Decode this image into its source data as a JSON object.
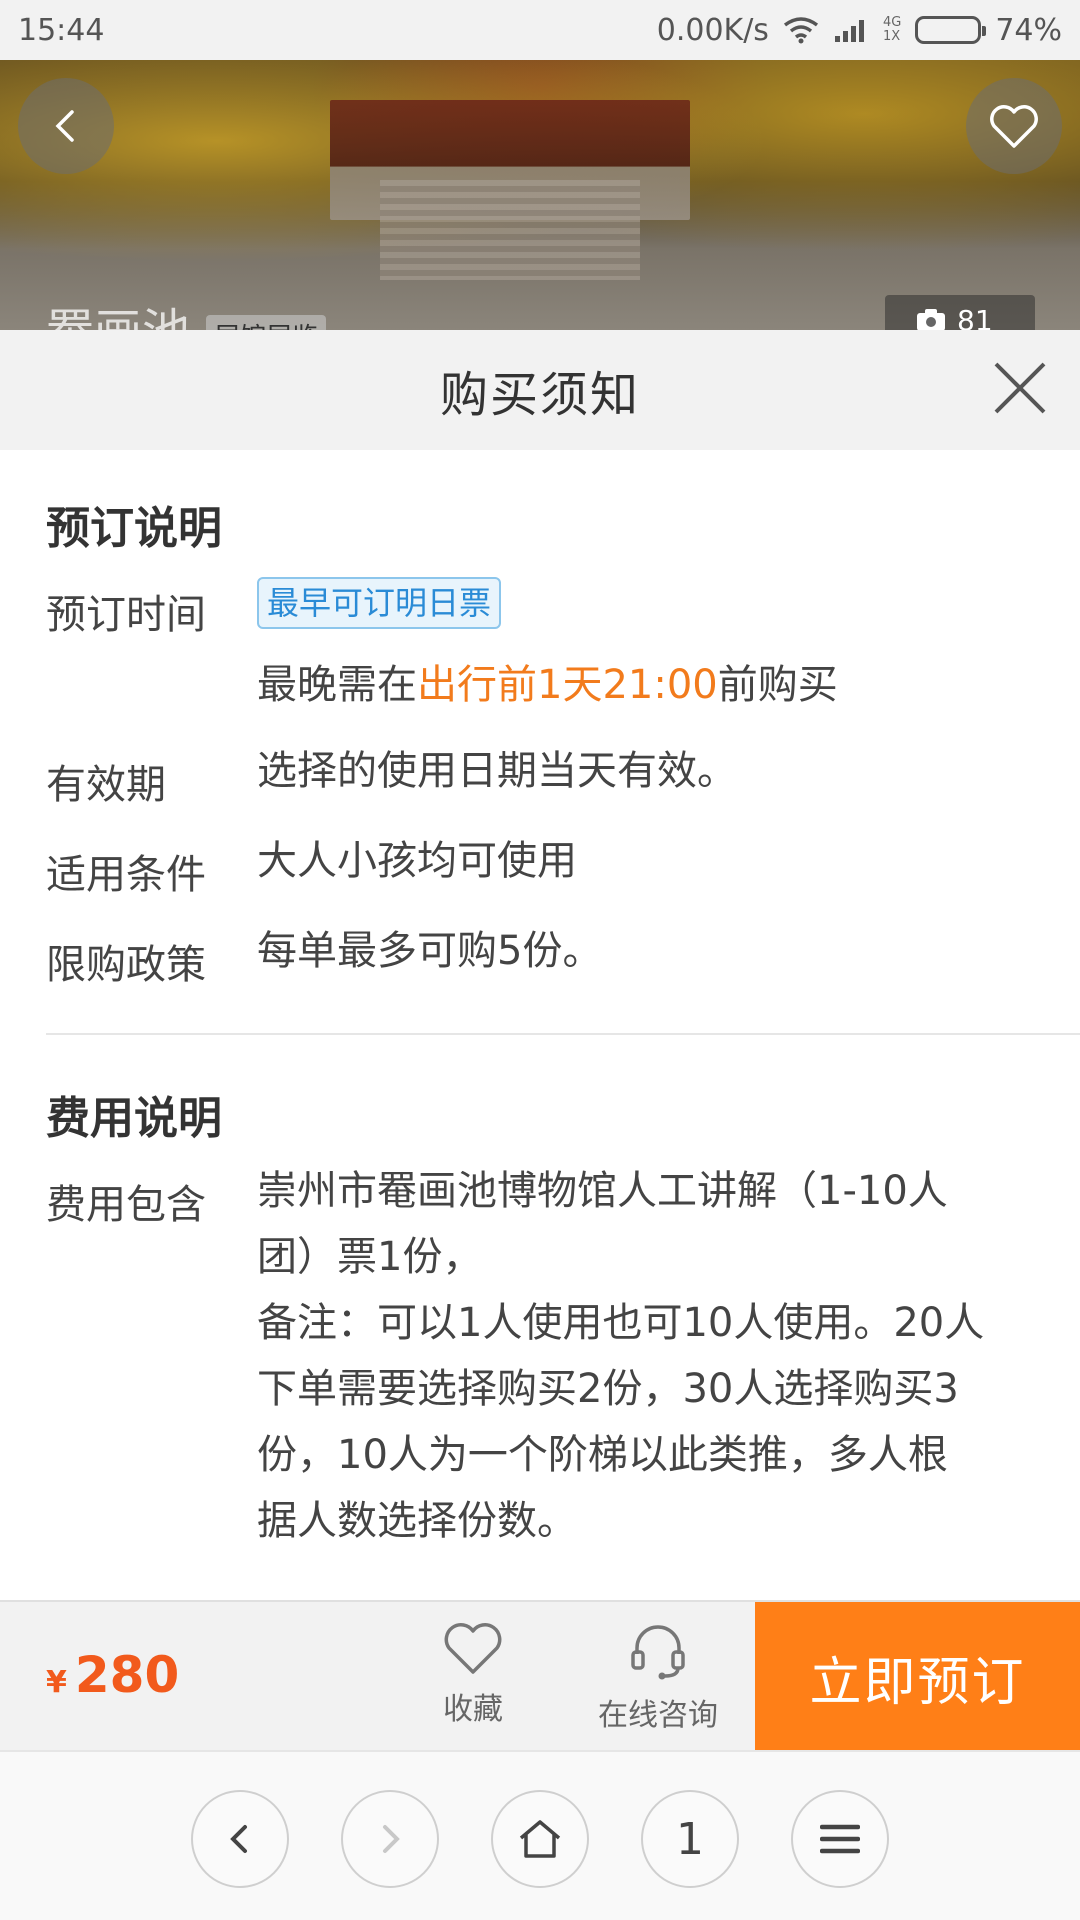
{
  "status_bar": {
    "time": "15:44",
    "speed": "0.00K/s",
    "network_top": "4G",
    "network_bottom": "1X",
    "battery": "74%"
  },
  "hero": {
    "title": "罨画池",
    "tag": "展馆展览",
    "photo_count": "81"
  },
  "sheet": {
    "title": "购买须知"
  },
  "booking": {
    "section_title": "预订说明",
    "time_label": "预订时间",
    "time_badge": "最早可订明日票",
    "time_note_prefix": "最晚需在",
    "time_note_highlight": "出行前1天21:00",
    "time_note_suffix": "前购买",
    "validity_label": "有效期",
    "validity_value": "选择的使用日期当天有效。",
    "conditions_label": "适用条件",
    "conditions_value": "大人小孩均可使用",
    "limit_label": "限购政策",
    "limit_value": "每单最多可购5份。"
  },
  "fees": {
    "section_title": "费用说明",
    "includes_label": "费用包含",
    "includes_line1": "崇州市罨画池博物馆人工讲解（1-10人",
    "includes_line2": "团）票1份，",
    "includes_line3": "备注：可以1人使用也可10人使用。20人",
    "includes_line4": "下单需要选择购买2份，30人选择购买3",
    "includes_line5": "份，10人为一个阶梯以此类推，多人根",
    "includes_line6": "据人数选择份数。"
  },
  "action_bar": {
    "currency": "¥",
    "price": "280",
    "favorite_label": "收藏",
    "consult_label": "在线咨询",
    "book_label": "立即预订"
  },
  "browser_nav": {
    "tab_count": "1"
  },
  "colors": {
    "accent_orange": "#ff7f17",
    "price_red": "#f25a1c",
    "badge_blue": "#2a8bd6"
  },
  "icons": {
    "back": "chevron-left-icon",
    "favorite": "heart-icon",
    "camera": "camera-icon",
    "close": "close-icon",
    "consult": "headset-icon",
    "home": "home-icon",
    "menu": "menu-icon"
  }
}
